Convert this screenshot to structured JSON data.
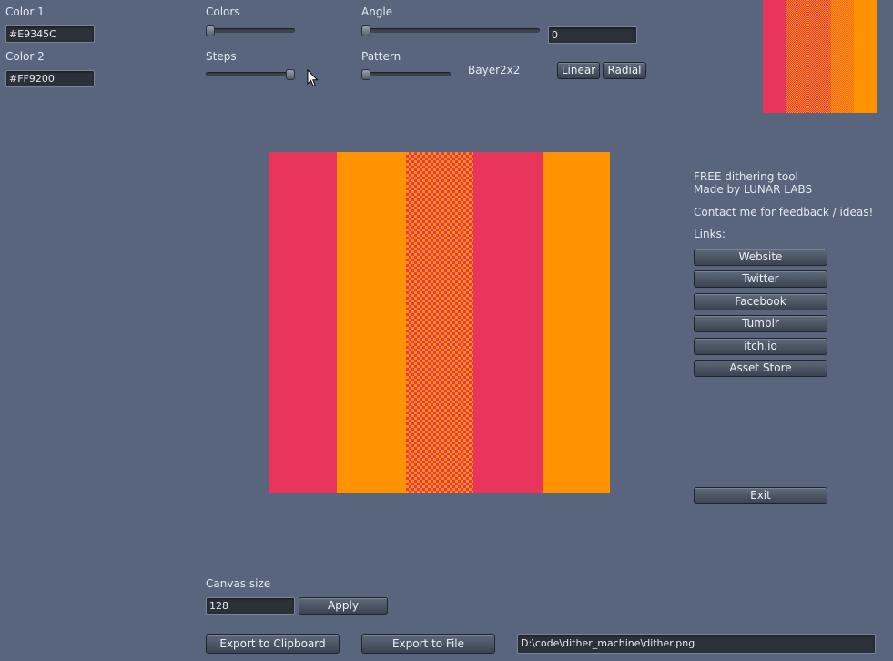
{
  "colors": {
    "color1_hex": "#E9345C",
    "color2_hex": "#FF9200",
    "background": "#58657c"
  },
  "left_panel": {
    "color1_label": "Color 1",
    "color1_value": "#E9345C",
    "color2_label": "Color 2",
    "color2_value": "#FF9200"
  },
  "sliders": {
    "colors_label": "Colors",
    "colors_level": 0.0,
    "steps_label": "Steps",
    "steps_level": 1.0,
    "angle_label": "Angle",
    "angle_level": 0.0,
    "angle_value": "0",
    "pattern_label": "Pattern",
    "pattern_level": 0.0,
    "pattern_name": "Bayer2x2"
  },
  "gradient_buttons": {
    "linear": "Linear",
    "radial": "Radial"
  },
  "info": {
    "line1": "FREE dithering tool",
    "line2": "Made by LUNAR LABS",
    "contact": "Contact me for feedback / ideas!",
    "links_label": "Links:"
  },
  "links": [
    "Website",
    "Twitter",
    "Facebook",
    "Tumblr",
    "itch.io",
    "Asset Store"
  ],
  "exit_label": "Exit",
  "canvas": {
    "size_label": "Canvas size",
    "size_value": "128",
    "apply_label": "Apply"
  },
  "export": {
    "clipboard_label": "Export to Clipboard",
    "file_label": "Export to File",
    "path_value": "D:\\code\\dither_machine\\dither.png"
  },
  "icons": {
    "cursor": "mouse-pointer-icon"
  }
}
